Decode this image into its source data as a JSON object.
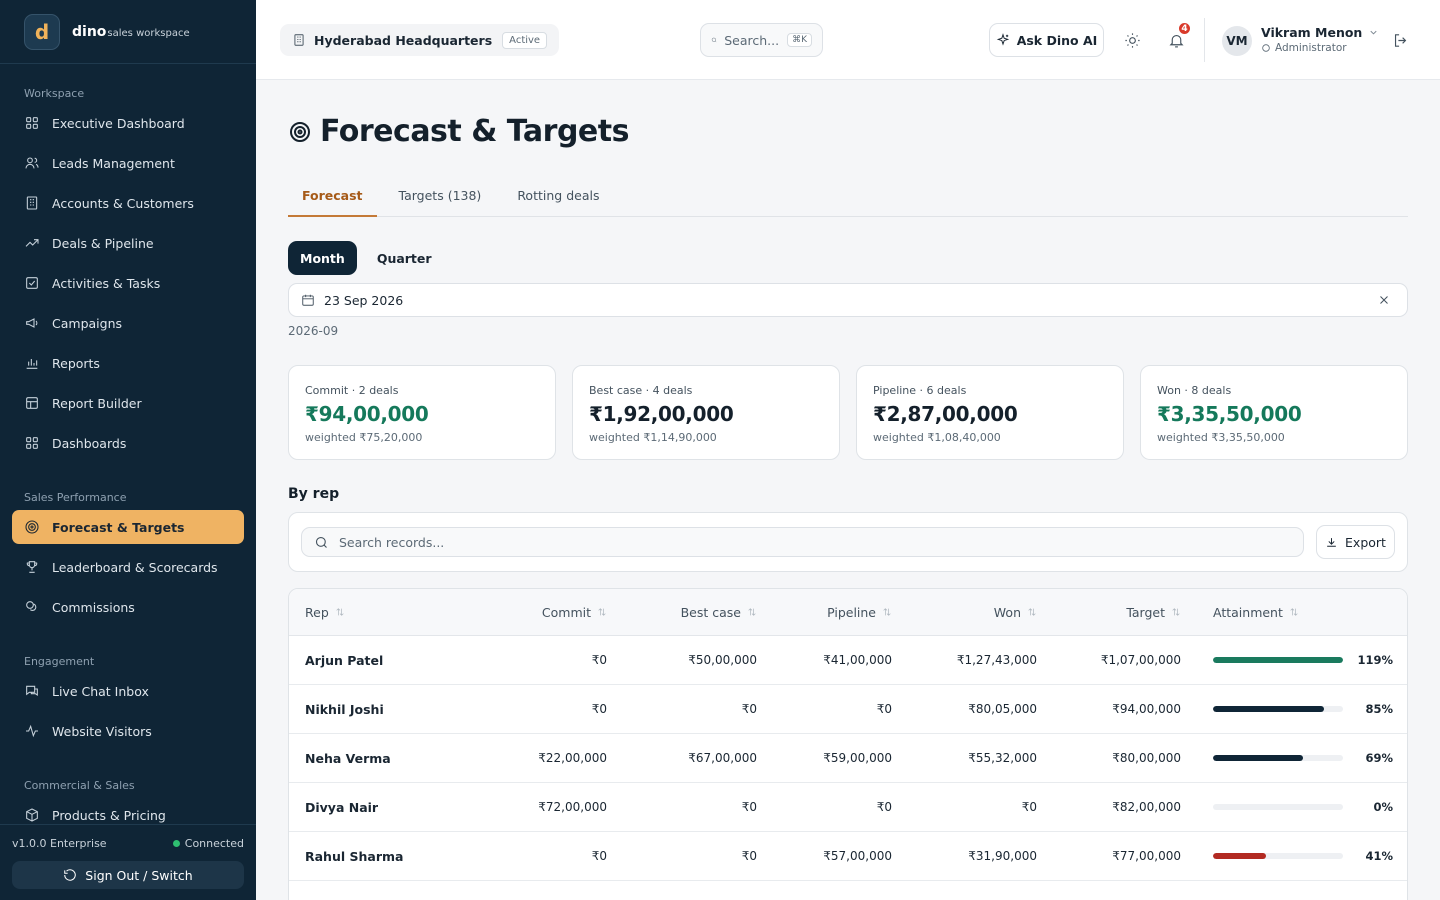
{
  "brand": {
    "logo_letter": "d",
    "name": "dino",
    "sub": "sales workspace"
  },
  "sidebar": {
    "sections": [
      {
        "heading": "Workspace",
        "items": [
          {
            "label": "Executive Dashboard",
            "icon": "grid-icon"
          },
          {
            "label": "Leads Management",
            "icon": "users-icon"
          },
          {
            "label": "Accounts & Customers",
            "icon": "building-icon"
          },
          {
            "label": "Deals & Pipeline",
            "icon": "trend-icon"
          },
          {
            "label": "Activities & Tasks",
            "icon": "check-square-icon"
          },
          {
            "label": "Campaigns",
            "icon": "megaphone-icon"
          },
          {
            "label": "Reports",
            "icon": "bar-chart-icon"
          },
          {
            "label": "Report Builder",
            "icon": "table-icon"
          },
          {
            "label": "Dashboards",
            "icon": "grid-icon"
          }
        ]
      },
      {
        "heading": "Sales Performance",
        "items": [
          {
            "label": "Forecast & Targets",
            "icon": "target-icon",
            "active": true
          },
          {
            "label": "Leaderboard & Scorecards",
            "icon": "trophy-icon"
          },
          {
            "label": "Commissions",
            "icon": "coins-icon"
          }
        ]
      },
      {
        "heading": "Engagement",
        "items": [
          {
            "label": "Live Chat Inbox",
            "icon": "chat-icon"
          },
          {
            "label": "Website Visitors",
            "icon": "activity-icon"
          }
        ]
      },
      {
        "heading": "Commercial & Sales",
        "items": [
          {
            "label": "Products & Pricing",
            "icon": "box-icon"
          }
        ]
      }
    ],
    "footer": {
      "version": "v1.0.0 Enterprise",
      "status": "Connected",
      "signout": "Sign Out / Switch"
    }
  },
  "topbar": {
    "org": "Hyderabad Headquarters",
    "org_status": "Active",
    "search_placeholder": "Search...",
    "search_kbd": "⌘K",
    "ask": "Ask Dino AI",
    "notif_count": "4",
    "user": {
      "initials": "VM",
      "name": "Vikram Menon",
      "role": "Administrator"
    }
  },
  "page": {
    "title": "Forecast & Targets",
    "tabs": [
      {
        "label": "Forecast",
        "active": true
      },
      {
        "label": "Targets (138)"
      },
      {
        "label": "Rotting deals"
      }
    ],
    "period_toggle": [
      {
        "label": "Month",
        "active": true
      },
      {
        "label": "Quarter"
      }
    ],
    "date": "23 Sep 2026",
    "period_code": "2026-09",
    "cards": [
      {
        "label": "Commit · 2 deals",
        "value": "₹94,00,000",
        "sub": "weighted ₹75,20,000",
        "color": "#15795b"
      },
      {
        "label": "Best case · 4 deals",
        "value": "₹1,92,00,000",
        "sub": "weighted ₹1,14,90,000",
        "color": "#14202b"
      },
      {
        "label": "Pipeline · 6 deals",
        "value": "₹2,87,00,000",
        "sub": "weighted ₹1,08,40,000",
        "color": "#14202b"
      },
      {
        "label": "Won · 8 deals",
        "value": "₹3,35,50,000",
        "sub": "weighted ₹3,35,50,000",
        "color": "#15795b"
      }
    ],
    "by_rep_title": "By rep",
    "records_search_placeholder": "Search records...",
    "export_label": "Export",
    "table": {
      "columns": [
        "Rep",
        "Commit",
        "Best case",
        "Pipeline",
        "Won",
        "Target",
        "Attainment"
      ],
      "rows": [
        {
          "rep": "Arjun Patel",
          "commit": "₹0",
          "best": "₹50,00,000",
          "pipeline": "₹41,00,000",
          "won": "₹1,27,43,000",
          "target": "₹1,07,00,000",
          "attainment": "119%",
          "att_value": 119,
          "bar_color": "#1a7a5e"
        },
        {
          "rep": "Nikhil Joshi",
          "commit": "₹0",
          "best": "₹0",
          "pipeline": "₹0",
          "won": "₹80,05,000",
          "target": "₹94,00,000",
          "attainment": "85%",
          "att_value": 85,
          "bar_color": "#0f2536"
        },
        {
          "rep": "Neha Verma",
          "commit": "₹22,00,000",
          "best": "₹67,00,000",
          "pipeline": "₹59,00,000",
          "won": "₹55,32,000",
          "target": "₹80,00,000",
          "attainment": "69%",
          "att_value": 69,
          "bar_color": "#0f2536"
        },
        {
          "rep": "Divya Nair",
          "commit": "₹72,00,000",
          "best": "₹0",
          "pipeline": "₹0",
          "won": "₹0",
          "target": "₹82,00,000",
          "attainment": "0%",
          "att_value": 0,
          "bar_color": "#0f2536"
        },
        {
          "rep": "Rahul Sharma",
          "commit": "₹0",
          "best": "₹0",
          "pipeline": "₹57,00,000",
          "won": "₹31,90,000",
          "target": "₹77,00,000",
          "attainment": "41%",
          "att_value": 41,
          "bar_color": "#b22a22"
        }
      ]
    }
  }
}
